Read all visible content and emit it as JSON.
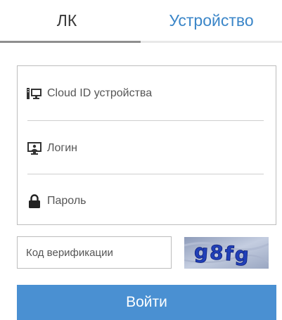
{
  "tabs": {
    "account_label": "ЛК",
    "device_label": "Устройство",
    "active": "device"
  },
  "form": {
    "cloud_id_placeholder": "Cloud ID устройства",
    "login_placeholder": "Логин",
    "password_placeholder": "Пароль",
    "verification_placeholder": "Код верификации",
    "captcha_text": "g8fg",
    "submit_label": "Войти"
  },
  "colors": {
    "accent": "#4a90d2",
    "active_tab_text": "#3b86c8",
    "border": "#bdbdbd"
  },
  "icons": {
    "cloud_id": "device-id-icon",
    "login": "user-monitor-icon",
    "password": "lock-icon"
  }
}
